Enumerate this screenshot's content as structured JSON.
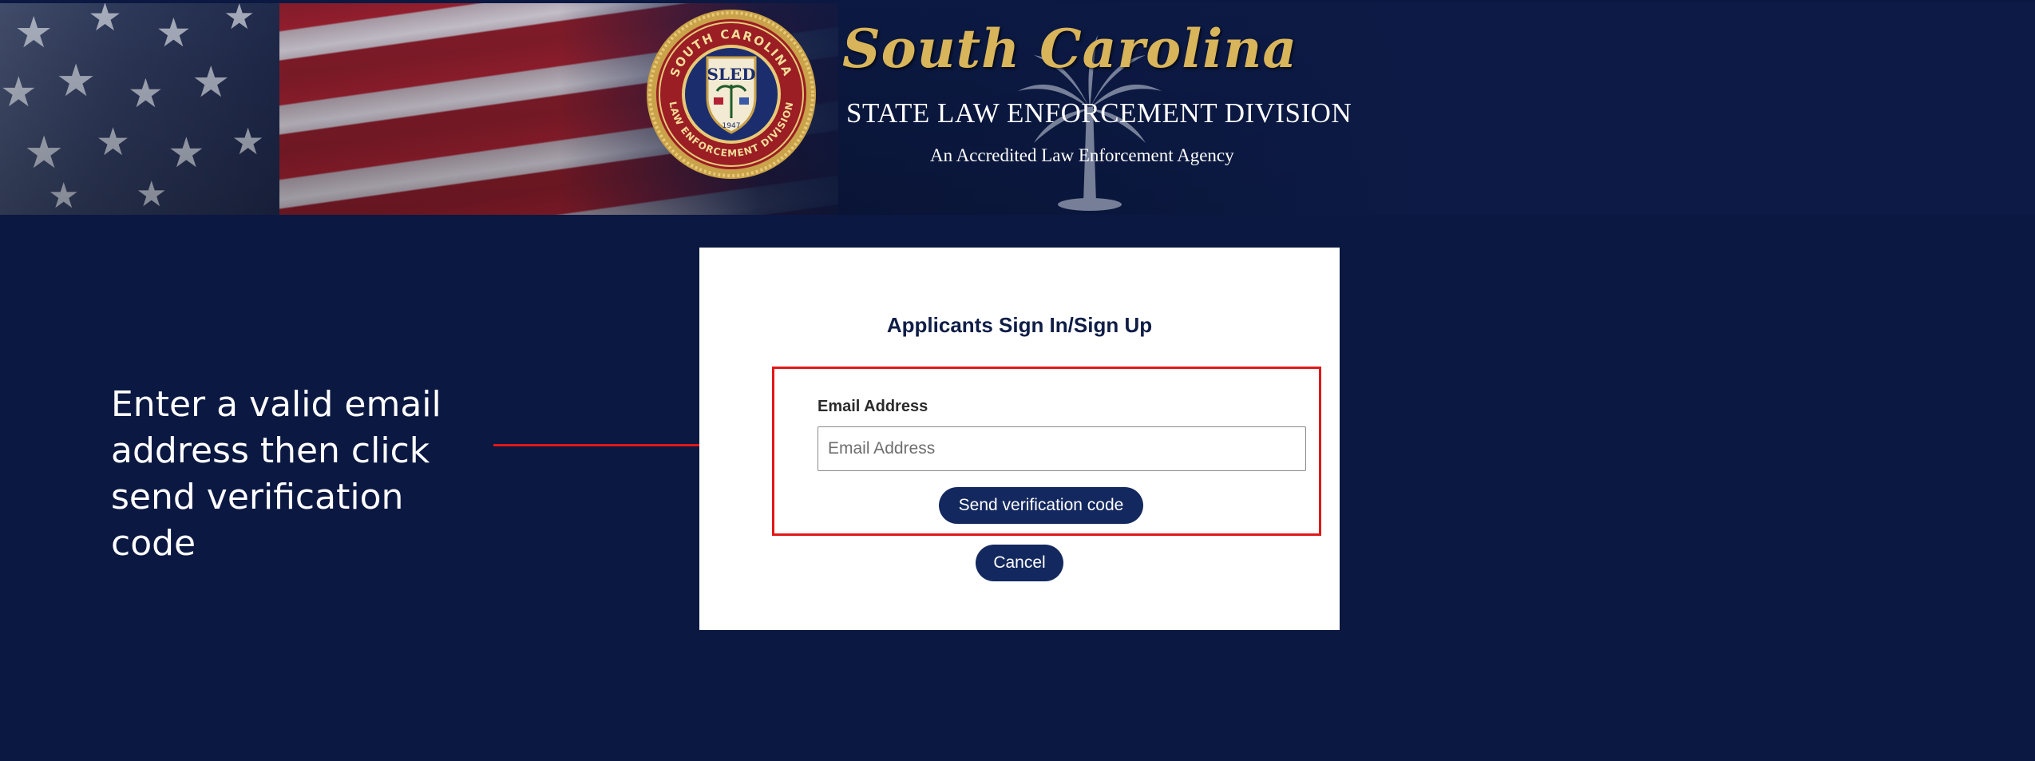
{
  "banner": {
    "state_script": "South Carolina",
    "agency_name": "STATE LAW ENFORCEMENT DIVISION",
    "tagline": "An Accredited Law Enforcement Agency",
    "seal": {
      "top_text": "SOUTH CAROLINA",
      "bottom_text": "LAW ENFORCEMENT DIVISION",
      "center_text": "SLED",
      "year": "1947"
    }
  },
  "annotation": {
    "instruction": "Enter a valid email address then click send verification code",
    "line_1": "Enter a valid email",
    "line_2": "address then click",
    "line_3": "send verification code",
    "color": "#e01818"
  },
  "signin": {
    "title": "Applicants Sign In/Sign Up",
    "email_label": "Email Address",
    "email_placeholder": "Email Address",
    "email_value": "",
    "send_code_label": "Send verification code",
    "cancel_label": "Cancel"
  },
  "colors": {
    "page_background": "#0b1842",
    "button_background": "#13285e",
    "highlight": "#e01818",
    "script_gold": "#d8b45a"
  }
}
